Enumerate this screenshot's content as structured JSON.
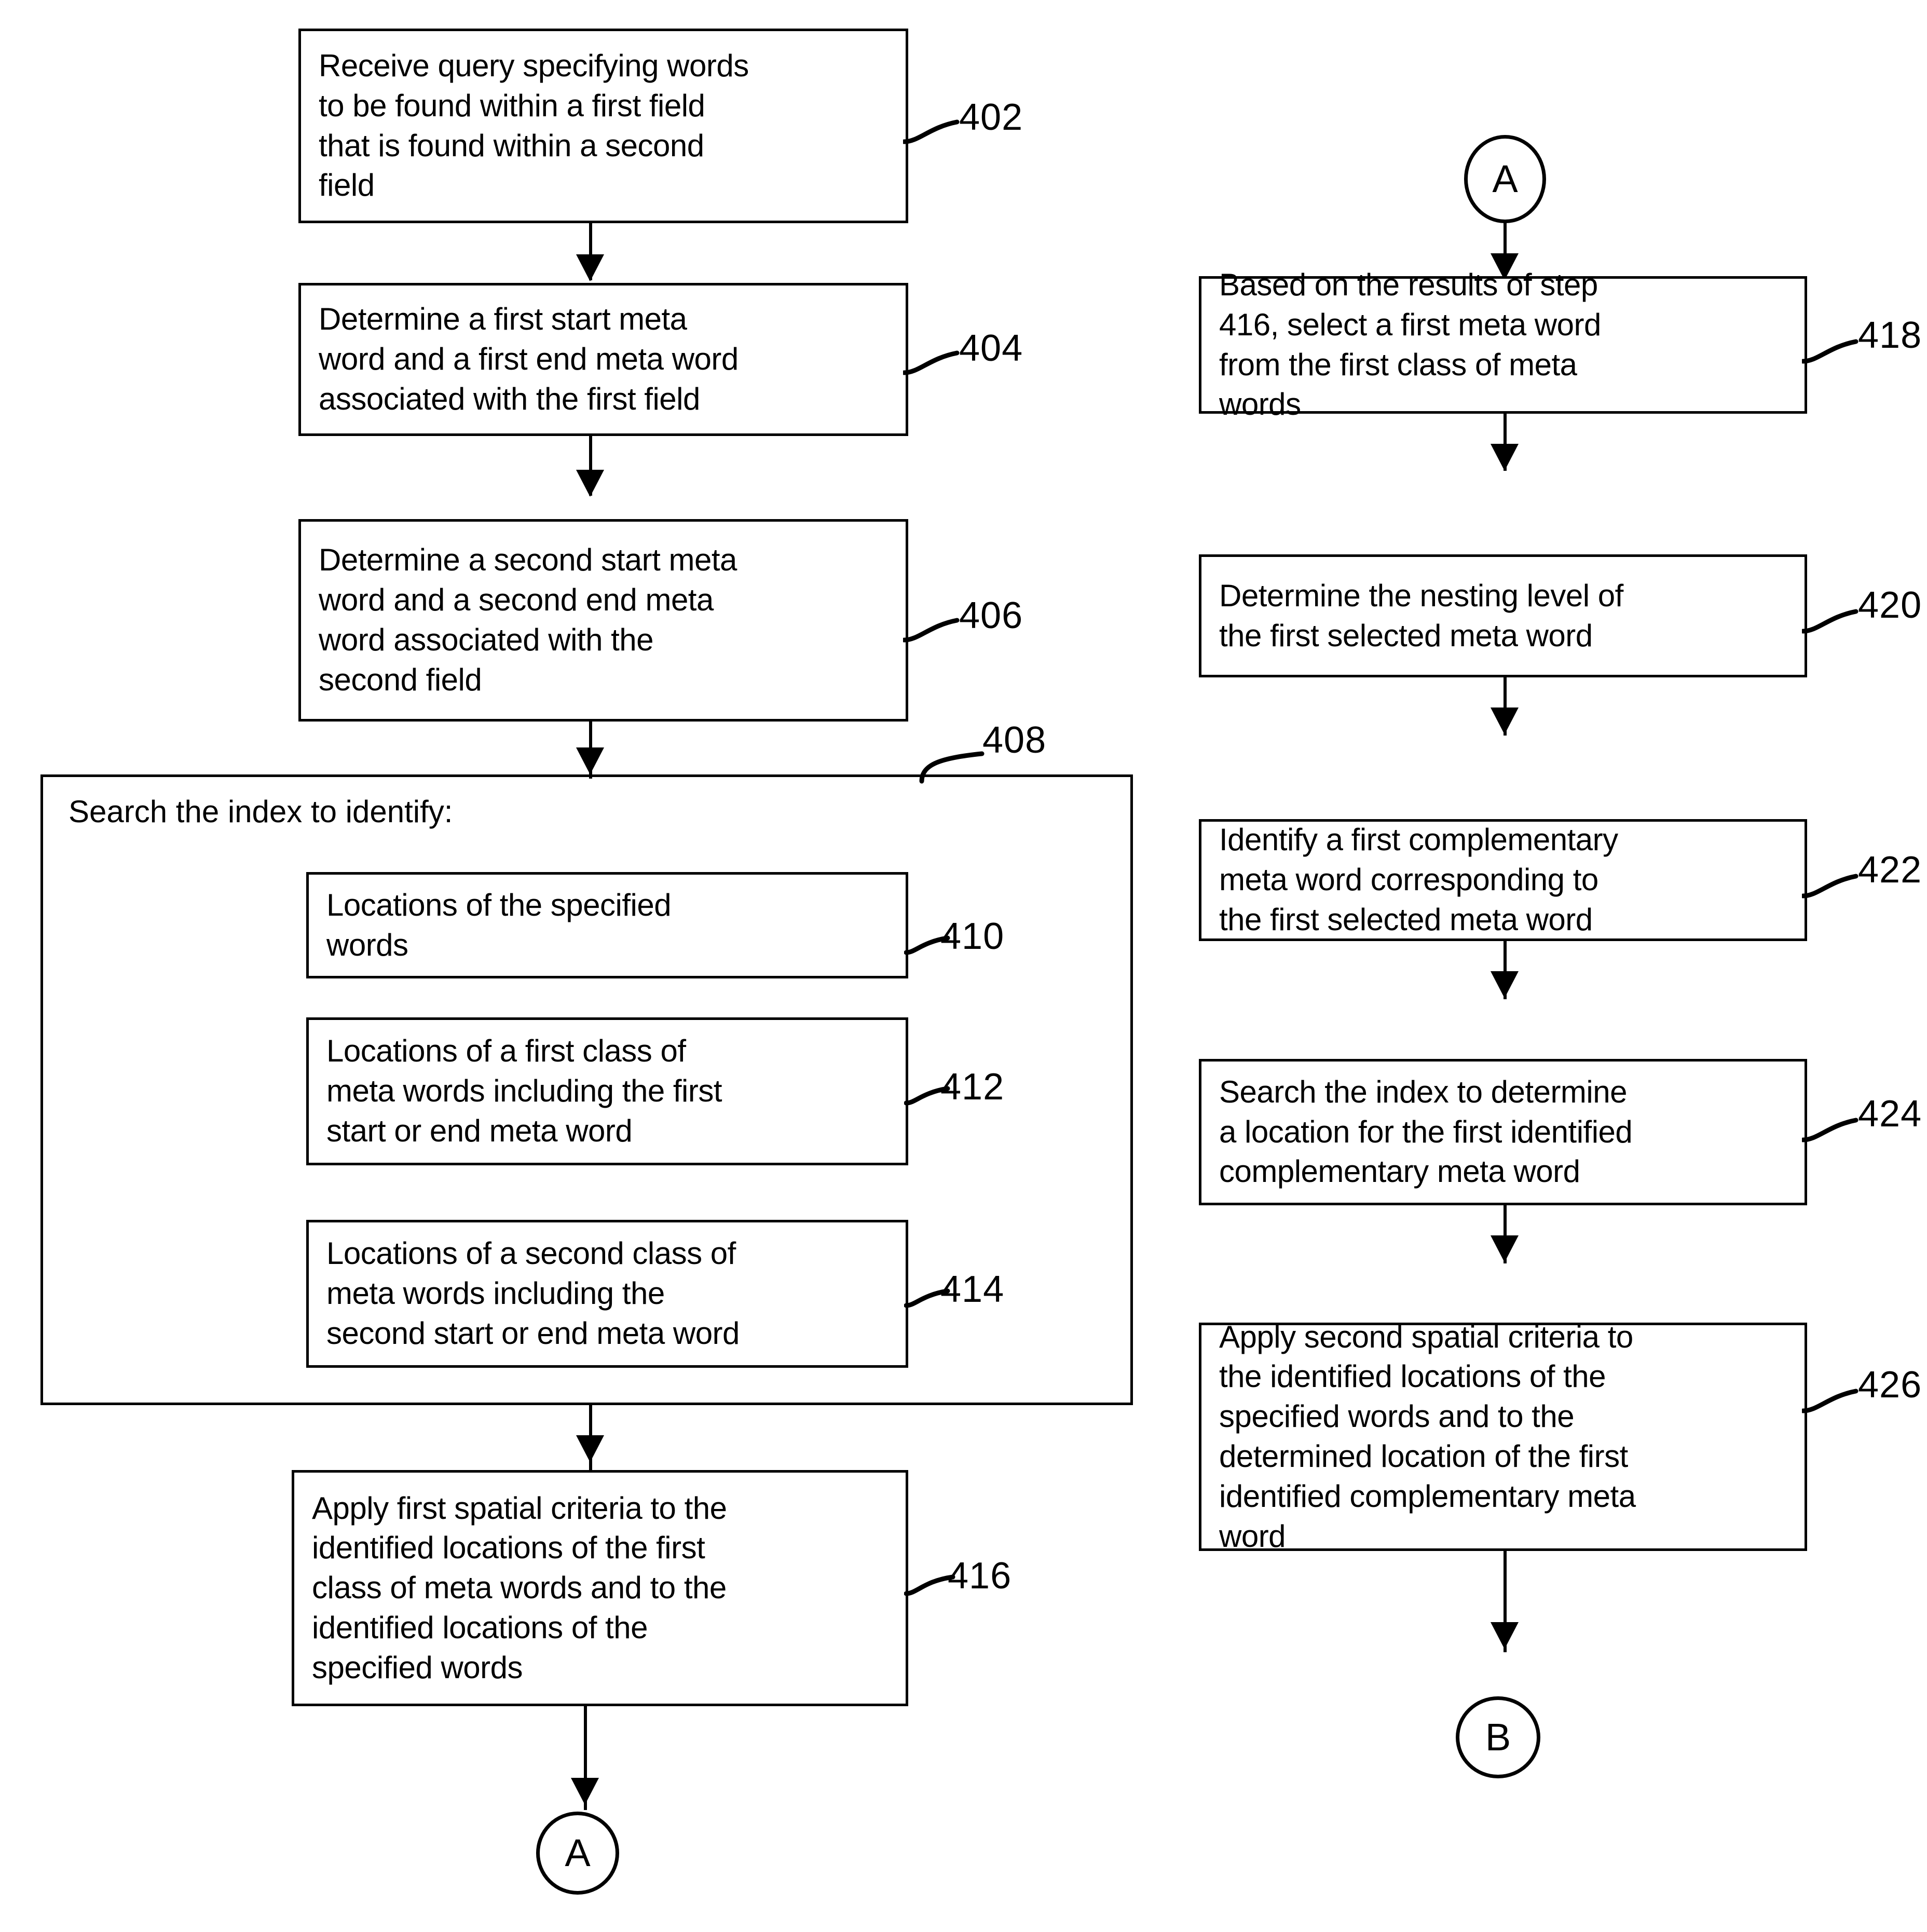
{
  "diagram": {
    "type": "patent-flowchart",
    "columns": [
      {
        "name": "left-column",
        "nodes": [
          {
            "ref": "402",
            "text": "Receive query specifying words to be found within a first field that is found within a second field"
          },
          {
            "ref": "404",
            "text": "Determine a first start meta word and a first end meta word associated with the first field"
          },
          {
            "ref": "406",
            "text": "Determine a second start meta word and a second end meta word associated with the second field"
          },
          {
            "ref": "408",
            "title": "Search the index to identify:",
            "children": [
              {
                "ref": "410",
                "text": "Locations of the specified words"
              },
              {
                "ref": "412",
                "text": "Locations of a first class of meta words including the first start or end meta word"
              },
              {
                "ref": "414",
                "text": "Locations of a second class of meta words including the second start or end meta word"
              }
            ]
          },
          {
            "ref": "416",
            "text": "Apply first spatial criteria to the identified locations of the first class of meta words and to the identified locations of the specified words"
          },
          {
            "connector": "A"
          }
        ]
      },
      {
        "name": "right-column",
        "nodes": [
          {
            "connector": "A"
          },
          {
            "ref": "418",
            "text": "Based on the results of step 416, select a first meta word from the first class of meta words"
          },
          {
            "ref": "420",
            "text": "Determine the nesting level of the first selected meta word"
          },
          {
            "ref": "422",
            "text": "Identify a first complementary meta word corresponding to the first selected meta word"
          },
          {
            "ref": "424",
            "text": "Search the index to determine a location for the first identified complementary meta word"
          },
          {
            "ref": "426",
            "text": "Apply second spatial criteria to the identified locations of the specified words and to the determined location of the first identified complementary meta word"
          },
          {
            "connector": "B"
          }
        ]
      }
    ]
  },
  "left": {
    "box402": {
      "text": "Receive query specifying words\nto be found within a first field\nthat is found within a second\nfield",
      "ref": "402"
    },
    "box404": {
      "text": "Determine a first start meta\nword and a first end meta word\nassociated with the first field",
      "ref": "404"
    },
    "box406": {
      "text": "Determine a second start meta\nword and a second end meta\nword associated with the\nsecond field",
      "ref": "406"
    },
    "box408": {
      "title": "Search the index to identify:",
      "ref": "408"
    },
    "box410": {
      "text": "Locations of the specified\nwords",
      "ref": "410"
    },
    "box412": {
      "text": "Locations of a first class of\nmeta words including the first\nstart or end meta word",
      "ref": "412"
    },
    "box414": {
      "text": "Locations of a second class of\nmeta words including the\nsecond start or end meta word",
      "ref": "414"
    },
    "box416": {
      "text": "Apply first spatial criteria to the\nidentified locations of the first\nclass of meta words and to the\nidentified locations of the\nspecified words",
      "ref": "416"
    },
    "connector_a": "A"
  },
  "right": {
    "connector_a": "A",
    "box418": {
      "text": "Based on the results of step\n416, select a first meta word\nfrom the first class of meta\nwords",
      "ref": "418"
    },
    "box420": {
      "text": "Determine the nesting level of\nthe first selected meta word",
      "ref": "420"
    },
    "box422": {
      "text": "Identify a first complementary\nmeta word corresponding to\nthe first selected meta word",
      "ref": "422"
    },
    "box424": {
      "text": "Search the index to determine\na location for the first identified\ncomplementary meta word",
      "ref": "424"
    },
    "box426": {
      "text": "Apply second spatial criteria to\nthe identified locations of the\nspecified words and to the\ndetermined location of the first\nidentified complementary meta\nword",
      "ref": "426"
    },
    "connector_b": "B"
  },
  "colors": {
    "stroke": "#000000",
    "background": "#ffffff"
  }
}
